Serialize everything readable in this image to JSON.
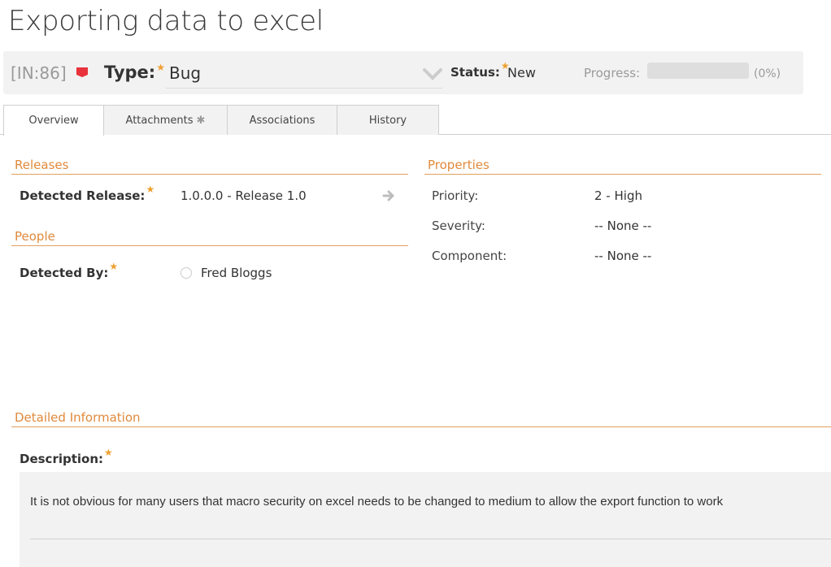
{
  "page": {
    "title": "Exporting data to excel"
  },
  "header": {
    "incident_id": "[IN:86]",
    "type_label": "Type:",
    "type_value": "Bug",
    "status_label": "Status:",
    "status_value": "New",
    "progress_label": "Progress:",
    "progress_text": "(0%)",
    "progress_fraction": 0,
    "required_marker": "★",
    "colors": {
      "flag": "#e8323c",
      "required": "#f0a030",
      "heading": "#e08a3c"
    }
  },
  "tabs": [
    {
      "label": "Overview"
    },
    {
      "label": "Attachments"
    },
    {
      "label": "Associations"
    },
    {
      "label": "History"
    }
  ],
  "releases": {
    "heading": "Releases",
    "detected_release_label": "Detected Release:",
    "detected_release_value": "1.0.0.0 - Release 1.0"
  },
  "people": {
    "heading": "People",
    "detected_by_label": "Detected By:",
    "detected_by_value": "Fred Bloggs"
  },
  "properties": {
    "heading": "Properties",
    "priority_label": "Priority:",
    "priority_value": "2 - High",
    "severity_label": "Severity:",
    "severity_value": "-- None --",
    "component_label": "Component:",
    "component_value": "-- None --"
  },
  "details": {
    "heading": "Detailed Information",
    "description_label": "Description:",
    "description_text": "It is not obvious for many users that macro security on excel needs to be changed to medium to allow the export function to work"
  }
}
